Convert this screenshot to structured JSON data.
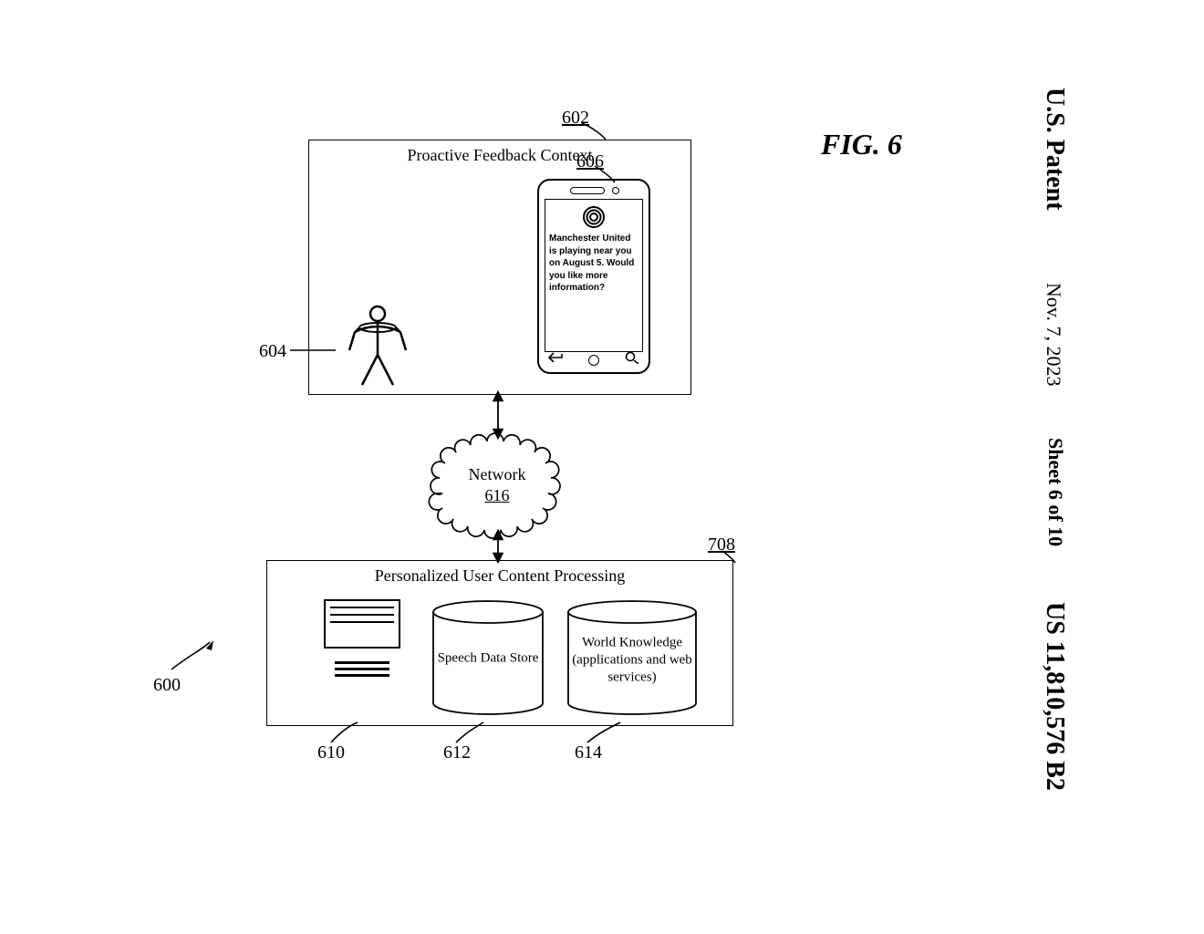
{
  "header": {
    "patent": "U.S. Patent",
    "date": "Nov. 7, 2023",
    "sheet": "Sheet 6 of 10",
    "docno": "US 11,810,576 B2"
  },
  "figure_label": "FIG. 6",
  "top_box": {
    "title": "Proactive Feedback Context"
  },
  "phone": {
    "message": "Manchester United is playing near you on August 5. Would you like more information?"
  },
  "network": {
    "label": "Network",
    "ref": "616"
  },
  "bottom_box": {
    "title": "Personalized User Content Processing"
  },
  "cylinders": {
    "speech": "Speech Data Store",
    "world": "World Knowledge (applications and web services)"
  },
  "refs": {
    "overall": "600",
    "topbox": "602",
    "user": "604",
    "phone": "606",
    "bottombox": "708",
    "computer": "610",
    "cyl_speech": "612",
    "cyl_world": "614"
  }
}
